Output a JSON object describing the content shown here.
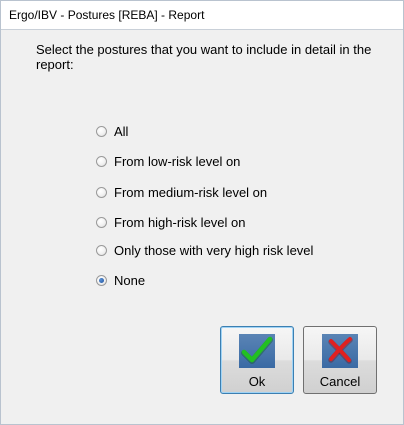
{
  "window": {
    "title": "Ergo/IBV - Postures [REBA] - Report"
  },
  "instruction": "Select the postures that you want to include in detail in the report:",
  "options": [
    {
      "label": "All",
      "checked": false
    },
    {
      "label": "From low-risk level on",
      "checked": false
    },
    {
      "label": "From medium-risk level on",
      "checked": false
    },
    {
      "label": "From high-risk level on",
      "checked": false
    },
    {
      "label": "Only those with very high risk level",
      "checked": false
    },
    {
      "label": "None",
      "checked": true
    }
  ],
  "buttons": {
    "ok": {
      "label": "Ok",
      "icon": "green-checkmark-icon"
    },
    "cancel": {
      "label": "Cancel",
      "icon": "red-x-icon"
    }
  },
  "colors": {
    "ok_mark": "#22c022",
    "cancel_mark": "#e02020",
    "icon_tile": "#4a78ad"
  }
}
